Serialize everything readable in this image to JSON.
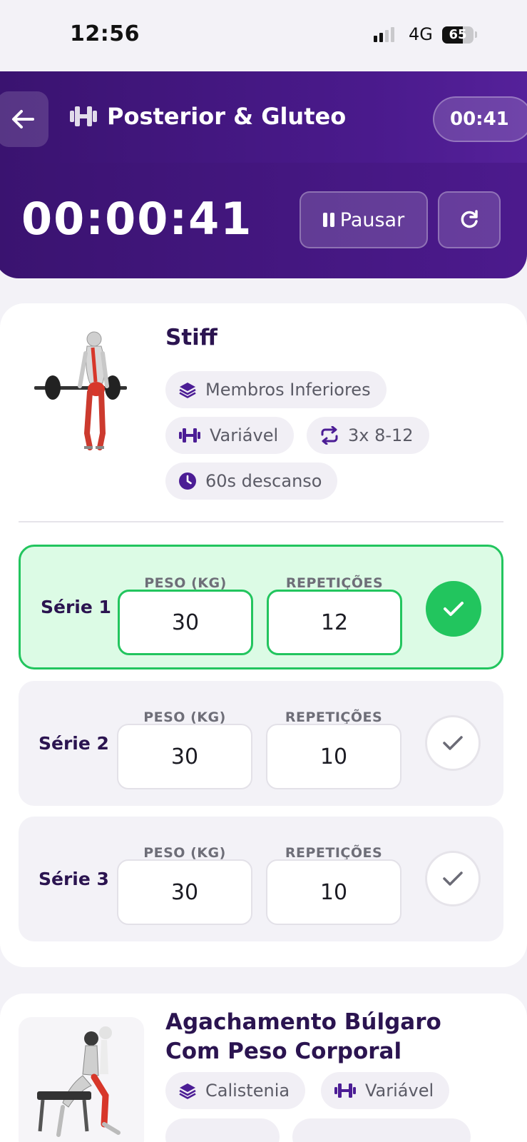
{
  "status_bar": {
    "time": "12:56",
    "network": "4G",
    "battery": "65",
    "battery_level": 0.65
  },
  "header": {
    "title": "Posterior & Gluteo",
    "elapsed": "00:41"
  },
  "timer": {
    "display": "00:00:41",
    "pause_label": "Pausar"
  },
  "exercises": [
    {
      "name": "Stiff",
      "tags": [
        {
          "icon": "layers-icon",
          "label": "Membros Inferiores"
        },
        {
          "icon": "dumbbell-icon",
          "label": "Variável"
        },
        {
          "icon": "repeat-icon",
          "label": "3x 8-12"
        },
        {
          "icon": "clock-icon",
          "label": "60s descanso"
        }
      ],
      "sets": [
        {
          "label": "Série 1",
          "weight_label": "PESO (KG)",
          "reps_label": "REPETIÇÕES",
          "weight": "30",
          "reps": "12",
          "done": true
        },
        {
          "label": "Série 2",
          "weight_label": "PESO (KG)",
          "reps_label": "REPETIÇÕES",
          "weight": "30",
          "reps": "10",
          "done": false
        },
        {
          "label": "Série 3",
          "weight_label": "PESO (KG)",
          "reps_label": "REPETIÇÕES",
          "weight": "30",
          "reps": "10",
          "done": false
        }
      ]
    },
    {
      "name_line1": "Agachamento Búlgaro",
      "name_line2": "Com Peso Corporal",
      "tags": [
        {
          "icon": "layers-icon",
          "label": "Calistenia"
        },
        {
          "icon": "dumbbell-icon",
          "label": "Variável"
        }
      ]
    }
  ],
  "colors": {
    "brand": "#3a1370",
    "accent": "#5b21b6",
    "success": "#22c55e",
    "chip_icon": "#4c1d95"
  }
}
